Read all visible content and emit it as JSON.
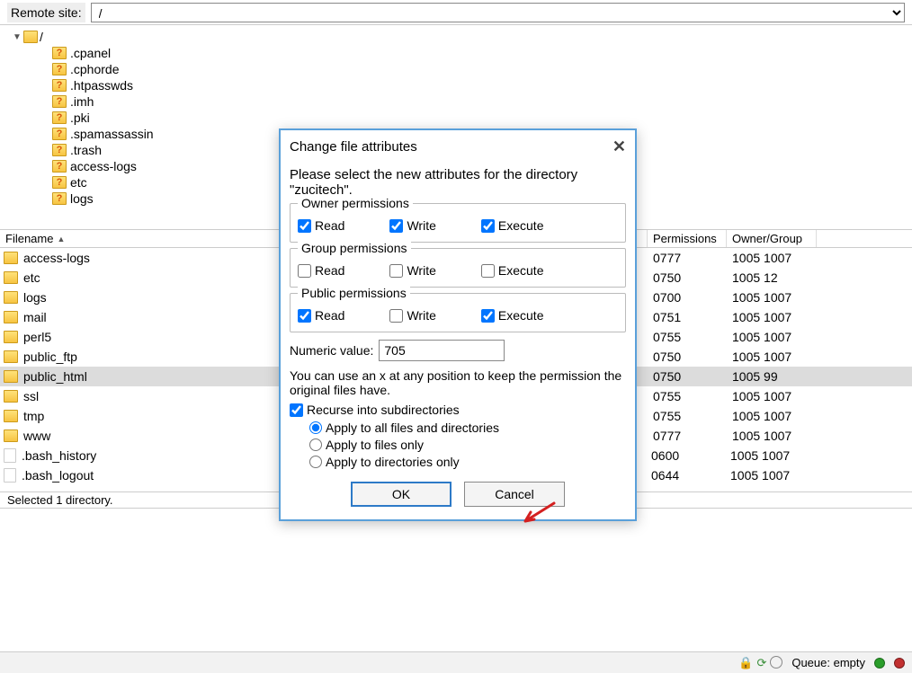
{
  "remote": {
    "label": "Remote site:",
    "path": "/"
  },
  "tree": {
    "root": "/",
    "items": [
      ".cpanel",
      ".cphorde",
      ".htpasswds",
      ".imh",
      ".pki",
      ".spamassassin",
      ".trash",
      "access-logs",
      "etc",
      "logs"
    ]
  },
  "list": {
    "columns": {
      "filename": "Filename",
      "permissions": "Permissions",
      "owner": "Owner/Group"
    },
    "rows": [
      {
        "name": "access-logs",
        "type": "folder",
        "perm": "0777",
        "owner": "1005 1007"
      },
      {
        "name": "etc",
        "type": "folder",
        "perm": "0750",
        "owner": "1005 12"
      },
      {
        "name": "logs",
        "type": "folder",
        "perm": "0700",
        "owner": "1005 1007"
      },
      {
        "name": "mail",
        "type": "folder",
        "perm": "0751",
        "owner": "1005 1007"
      },
      {
        "name": "perl5",
        "type": "folder",
        "perm": "0755",
        "owner": "1005 1007"
      },
      {
        "name": "public_ftp",
        "type": "folder",
        "perm": "0750",
        "owner": "1005 1007"
      },
      {
        "name": "public_html",
        "type": "folder",
        "perm": "0750",
        "owner": "1005 99",
        "selected": true
      },
      {
        "name": "ssl",
        "type": "folder",
        "perm": "0755",
        "owner": "1005 1007"
      },
      {
        "name": "tmp",
        "type": "folder",
        "perm": "0755",
        "owner": "1005 1007"
      },
      {
        "name": "www",
        "type": "folder",
        "perm": "0777",
        "owner": "1005 1007"
      },
      {
        "name": ".bash_history",
        "type": "file",
        "perm": "0600",
        "owner": "1005 1007"
      },
      {
        "name": ".bash_logout",
        "type": "file",
        "perm": "0644",
        "owner": "1005 1007"
      }
    ]
  },
  "status_mid": "Selected 1 directory.",
  "status_bottom": {
    "queue_label": "Queue: empty"
  },
  "dialog": {
    "title": "Change file attributes",
    "intro": "Please select the new attributes for the directory \"zucitech\".",
    "groups": {
      "owner": {
        "title": "Owner permissions",
        "read_label": "Read",
        "write_label": "Write",
        "execute_label": "Execute",
        "read": true,
        "write": true,
        "execute": true
      },
      "group": {
        "title": "Group permissions",
        "read_label": "Read",
        "write_label": "Write",
        "execute_label": "Execute",
        "read": false,
        "write": false,
        "execute": false
      },
      "public": {
        "title": "Public permissions",
        "read_label": "Read",
        "write_label": "Write",
        "execute_label": "Execute",
        "read": true,
        "write": false,
        "execute": true
      }
    },
    "numeric": {
      "label": "Numeric value:",
      "value": "705"
    },
    "hint": "You can use an x at any position to keep the permission the original files have.",
    "recurse": {
      "label": "Recurse into subdirectories",
      "checked": true
    },
    "radios": {
      "all": {
        "label": "Apply to all files and directories",
        "checked": true
      },
      "files": {
        "label": "Apply to files only",
        "checked": false
      },
      "dirs": {
        "label": "Apply to directories only",
        "checked": false
      }
    },
    "buttons": {
      "ok": "OK",
      "cancel": "Cancel"
    }
  }
}
